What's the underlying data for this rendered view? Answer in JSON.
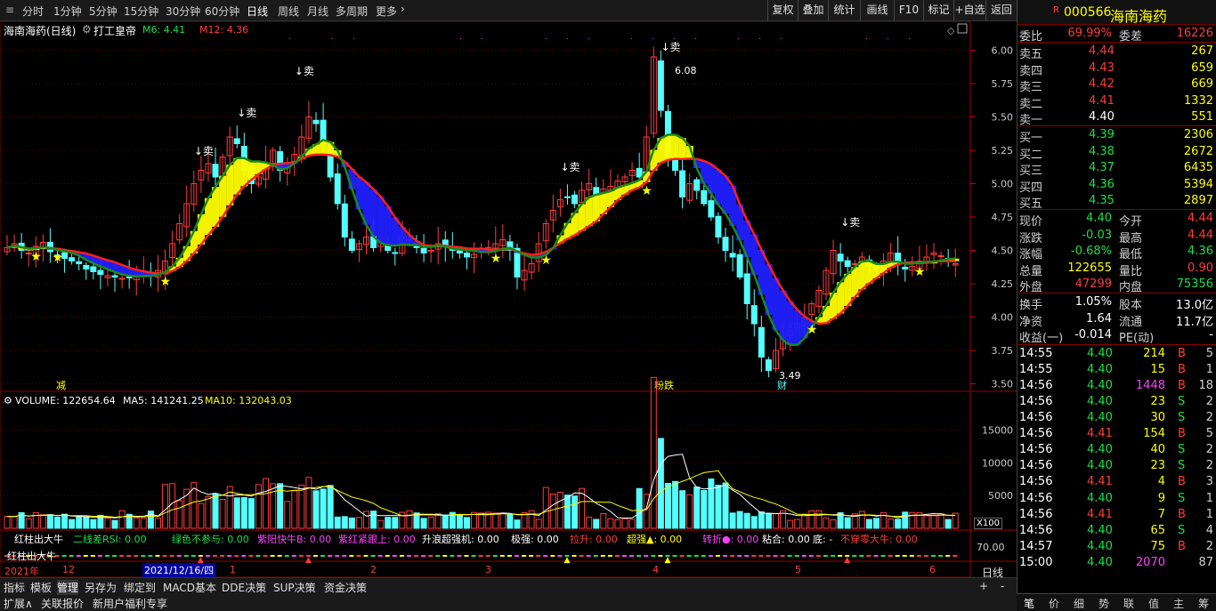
{
  "topbar": {
    "tabs": [
      "分时",
      "1分钟",
      "5分钟",
      "15分钟",
      "30分钟",
      "60分钟",
      "日线",
      "周线",
      "月线",
      "多周期",
      "更多"
    ],
    "right_buttons": [
      "复权",
      "叠加",
      "统计",
      "画线",
      "F10",
      "标记",
      "+自选",
      "返回"
    ]
  },
  "main_chart": {
    "title": "海南海药(日线)",
    "indicator_name": "打工皇帝",
    "m6": "M6: 4.41",
    "m12": "M12: 4.36",
    "price_ticks": [
      "6.00",
      "5.75",
      "5.50",
      "5.25",
      "5.00",
      "4.75",
      "4.50",
      "4.25",
      "4.00",
      "3.75",
      "3.50"
    ],
    "high_label": "6.08",
    "low_label": "3.49",
    "sell_label": "↓卖",
    "markers": [
      "减",
      "粉跌",
      "财"
    ]
  },
  "volume_panel": {
    "volume": "VOLUME: 122654.64",
    "ma5": "MA5: 141241.25",
    "ma10": "MA10: 132043.03",
    "ticks": [
      "15000",
      "10000",
      "5000"
    ],
    "unit": "X100"
  },
  "indicator_panel": {
    "items": [
      "红柱出大牛",
      "二线差RSI: 0.00",
      "绿色不参与: 0.00",
      "紫阳快牛B: 0.00",
      "紫红紧跟上: 0.00",
      "升浪超强机: 0.00",
      "极强: 0.00",
      "拉升: 0.00",
      "超强▲: 0.00",
      "转折●: 0.00",
      "粘合: 0.00",
      "底: -",
      "不穿零大牛: 0.00"
    ],
    "tick": "70.00",
    "sub_label": "红柱出大牛"
  },
  "date_axis": {
    "labels": [
      "2021年",
      "12",
      "2021/12/16/四",
      "1",
      "2",
      "3",
      "4",
      "5",
      "6"
    ],
    "period": "日线"
  },
  "bottom_tabs": [
    "指标",
    "模板",
    "管理",
    "另存为",
    "绑定到",
    "MACD基本",
    "DDE决策",
    "SUP决策",
    "资金决策"
  ],
  "bottom_tabs2": [
    "扩展∧",
    "关联报价",
    "新用户福利专享"
  ],
  "quote": {
    "code": "000566",
    "name": "海南海药",
    "weibi_label": "委比",
    "weibi": "69.99%",
    "weicha_label": "委差",
    "weicha": "16226",
    "asks": [
      {
        "label": "卖五",
        "price": "4.44",
        "vol": "267"
      },
      {
        "label": "卖四",
        "price": "4.43",
        "vol": "659"
      },
      {
        "label": "卖三",
        "price": "4.42",
        "vol": "669"
      },
      {
        "label": "卖二",
        "price": "4.41",
        "vol": "1332"
      },
      {
        "label": "卖一",
        "price": "4.40",
        "vol": "551"
      }
    ],
    "bids": [
      {
        "label": "买一",
        "price": "4.39",
        "vol": "2306"
      },
      {
        "label": "买二",
        "price": "4.38",
        "vol": "2672"
      },
      {
        "label": "买三",
        "price": "4.37",
        "vol": "6435"
      },
      {
        "label": "买四",
        "price": "4.36",
        "vol": "5394"
      },
      {
        "label": "买五",
        "price": "4.35",
        "vol": "2897"
      }
    ],
    "stats": [
      {
        "l1": "现价",
        "v1": "4.40",
        "l2": "今开",
        "v2": "4.44"
      },
      {
        "l1": "涨跌",
        "v1": "-0.03",
        "l2": "最高",
        "v2": "4.44"
      },
      {
        "l1": "涨幅",
        "v1": "-0.68%",
        "l2": "最低",
        "v2": "4.36"
      },
      {
        "l1": "总量",
        "v1": "122655",
        "l2": "量比",
        "v2": "0.90"
      },
      {
        "l1": "外盘",
        "v1": "47299",
        "l2": "内盘",
        "v2": "75356"
      }
    ],
    "stats2": [
      {
        "l1": "换手",
        "v1": "1.05%",
        "l2": "股本",
        "v2": "13.0亿"
      },
      {
        "l1": "净资",
        "v1": "1.64",
        "l2": "流通",
        "v2": "11.7亿"
      },
      {
        "l1": "收益(一)",
        "v1": "-0.014",
        "l2": "PE(动)",
        "v2": "-"
      }
    ],
    "ticks": [
      {
        "t": "14:55",
        "p": "4.40",
        "v": "214",
        "d": "B",
        "n": "5"
      },
      {
        "t": "14:55",
        "p": "4.40",
        "v": "15",
        "d": "B",
        "n": "1"
      },
      {
        "t": "14:56",
        "p": "4.40",
        "v": "1448",
        "d": "B",
        "n": "18"
      },
      {
        "t": "14:56",
        "p": "4.40",
        "v": "23",
        "d": "S",
        "n": "2"
      },
      {
        "t": "14:56",
        "p": "4.40",
        "v": "30",
        "d": "S",
        "n": "2"
      },
      {
        "t": "14:56",
        "p": "4.41",
        "v": "154",
        "d": "B",
        "n": "5"
      },
      {
        "t": "14:56",
        "p": "4.40",
        "v": "40",
        "d": "S",
        "n": "2"
      },
      {
        "t": "14:56",
        "p": "4.40",
        "v": "23",
        "d": "S",
        "n": "2"
      },
      {
        "t": "14:56",
        "p": "4.41",
        "v": "4",
        "d": "B",
        "n": "3"
      },
      {
        "t": "14:56",
        "p": "4.40",
        "v": "9",
        "d": "S",
        "n": "1"
      },
      {
        "t": "14:56",
        "p": "4.41",
        "v": "7",
        "d": "B",
        "n": "1"
      },
      {
        "t": "14:56",
        "p": "4.40",
        "v": "65",
        "d": "S",
        "n": "4"
      },
      {
        "t": "14:57",
        "p": "4.40",
        "v": "75",
        "d": "B",
        "n": "2"
      },
      {
        "t": "15:00",
        "p": "4.40",
        "v": "2070",
        "d": "",
        "n": "87"
      }
    ],
    "bottom_tabs": [
      "笔",
      "价",
      "细",
      "势",
      "联",
      "值",
      "主",
      "筹"
    ]
  },
  "chart_data": {
    "type": "candlestick",
    "ylim": [
      3.45,
      6.15
    ],
    "volume_ylim": [
      0,
      19000
    ],
    "closes": [
      4.52,
      4.55,
      4.5,
      4.48,
      4.53,
      4.56,
      4.49,
      4.46,
      4.44,
      4.42,
      4.4,
      4.36,
      4.34,
      4.32,
      4.31,
      4.3,
      4.29,
      4.3,
      4.31,
      4.33,
      4.32,
      4.35,
      4.42,
      4.55,
      4.7,
      4.85,
      5.0,
      5.1,
      5.15,
      5.05,
      5.2,
      5.35,
      5.3,
      5.1,
      5.0,
      5.05,
      5.15,
      5.25,
      5.1,
      5.15,
      5.22,
      5.35,
      5.5,
      5.45,
      5.3,
      5.05,
      4.85,
      4.6,
      4.5,
      4.55,
      4.6,
      4.52,
      4.56,
      4.5,
      4.48,
      4.6,
      4.58,
      4.52,
      4.48,
      4.5,
      4.55,
      4.53,
      4.5,
      4.48,
      4.45,
      4.47,
      4.5,
      4.52,
      4.55,
      4.58,
      4.5,
      4.3,
      4.35,
      4.4,
      4.55,
      4.7,
      4.8,
      4.88,
      4.9,
      4.85,
      4.95,
      5.0,
      4.92,
      4.96,
      4.98,
      5.02,
      5.05,
      5.1,
      5.05,
      5.35,
      5.95,
      5.55,
      5.2,
      5.1,
      4.9,
      5.0,
      4.95,
      4.85,
      4.75,
      4.6,
      4.5,
      4.45,
      4.3,
      4.1,
      3.95,
      3.7,
      3.6,
      3.75,
      3.85,
      3.9,
      3.95,
      4.0,
      4.1,
      4.2,
      4.35,
      4.5,
      4.42,
      4.38,
      4.4,
      4.45,
      4.38,
      4.36,
      4.42,
      4.48,
      4.4,
      4.36,
      4.38,
      4.42,
      4.45,
      4.48,
      4.46,
      4.42,
      4.4
    ]
  }
}
